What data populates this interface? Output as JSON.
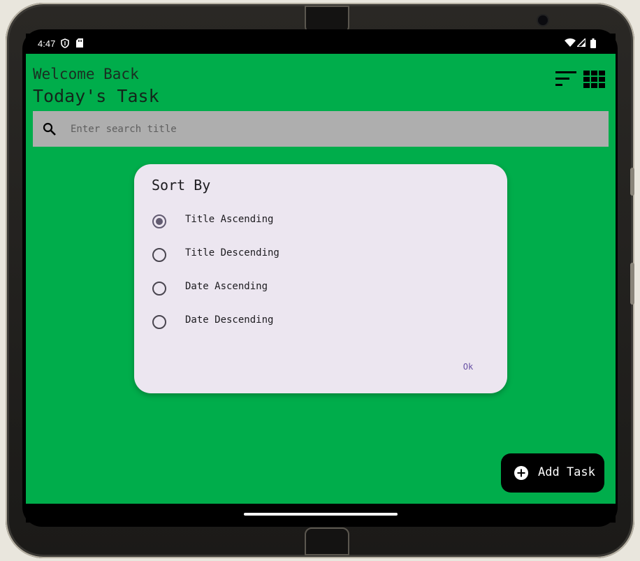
{
  "status_bar": {
    "time": "4:47"
  },
  "header": {
    "welcome": "Welcome Back",
    "title": "Today's Task"
  },
  "search": {
    "placeholder": "Enter search title"
  },
  "sort_dialog": {
    "title": "Sort By",
    "options": [
      {
        "label": "Title Ascending",
        "selected": true
      },
      {
        "label": "Title Descending",
        "selected": false
      },
      {
        "label": "Date Ascending",
        "selected": false
      },
      {
        "label": "Date Descending",
        "selected": false
      }
    ],
    "ok_label": "Ok"
  },
  "fab": {
    "label": "Add Task",
    "icon": "add-circle-icon"
  },
  "colors": {
    "app_background": "#00ad4b",
    "dialog_background": "#ece6f0",
    "accent": "#625b71",
    "ok_text": "#6750a4",
    "search_background": "#aeaeae"
  }
}
